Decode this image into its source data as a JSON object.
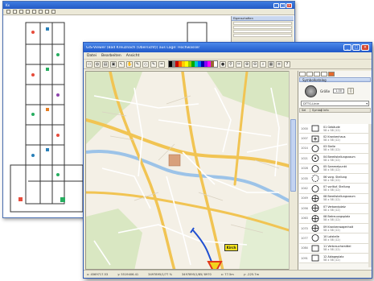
{
  "back_window": {
    "title": "Kx",
    "side_panel": {
      "header": "Eigenschaften",
      "rows": [
        "",
        "",
        "",
        ""
      ]
    }
  },
  "front_window": {
    "title": "GIS-Viewer (Bad Kreuznach (Übersicht)) aus Lage: Hochwasser",
    "menu": [
      "Datei",
      "Bearbeiten",
      "Ansicht"
    ],
    "statusbar": [
      "x: 4569717.53",
      "y: 5519406.41",
      "3497895/1/77 %",
      "3497895/1/85/ 8970",
      "x: 77.5m",
      "y: -225.7m"
    ]
  },
  "map": {
    "label_badge": "Kirch",
    "colors": {
      "road_main": "#f5d06b",
      "road_minor": "#ffffff",
      "water": "#9cc3e8",
      "forest": "#cfe4b0",
      "route": "#1f4fd1"
    }
  },
  "symbol_panel": {
    "title": "Symbolkatalog",
    "size_label": "Größe",
    "size_value": "1.00",
    "dropdown": "DTTG-Linie",
    "columns": [
      "Sel",
      "Symbol",
      "Info"
    ],
    "symbols": [
      {
        "name": "01 Gebäude",
        "size": "58 x 58 (12)",
        "shape": "rect"
      },
      {
        "name": "02 Krankenhaus",
        "size": "58 x 58 (12)",
        "shape": "rect-plus"
      },
      {
        "name": "03 Stelle",
        "size": "58 x 58 (12)",
        "shape": "circle"
      },
      {
        "name": "04 Bereitstellungsraum",
        "size": "58 x 58 (12)",
        "shape": "circle-dot"
      },
      {
        "name": "05 Sammelpunkt",
        "size": "58 x 58 (12)",
        "shape": "circle"
      },
      {
        "name": "06 vorg. Stellung",
        "size": "58 x 58 (12)",
        "shape": "circle-dash"
      },
      {
        "name": "07 vorläuf. Stellung",
        "size": "58 x 58 (12)",
        "shape": "circle"
      },
      {
        "name": "08 Bereitstellungsraum",
        "size": "58 x 58 (12)",
        "shape": "cross-circle"
      },
      {
        "name": "07 Verbandplatz",
        "size": "58 x 58 (12)",
        "shape": "cross-circle"
      },
      {
        "name": "08 Betreuungsplatz",
        "size": "58 x 58 (12)",
        "shape": "cross-circle"
      },
      {
        "name": "09 Krankenwagenhalt",
        "size": "58 x 58 (12)",
        "shape": "cross-circle"
      },
      {
        "name": "10 Lotstelle",
        "size": "58 x 58 (12)",
        "shape": "circle"
      },
      {
        "name": "11 Verbrauchsmittel",
        "size": "58 x 58 (12)",
        "shape": "rect"
      },
      {
        "name": "12 Ablageplatz",
        "size": "58 x 58 (12)",
        "shape": "rect"
      }
    ]
  }
}
